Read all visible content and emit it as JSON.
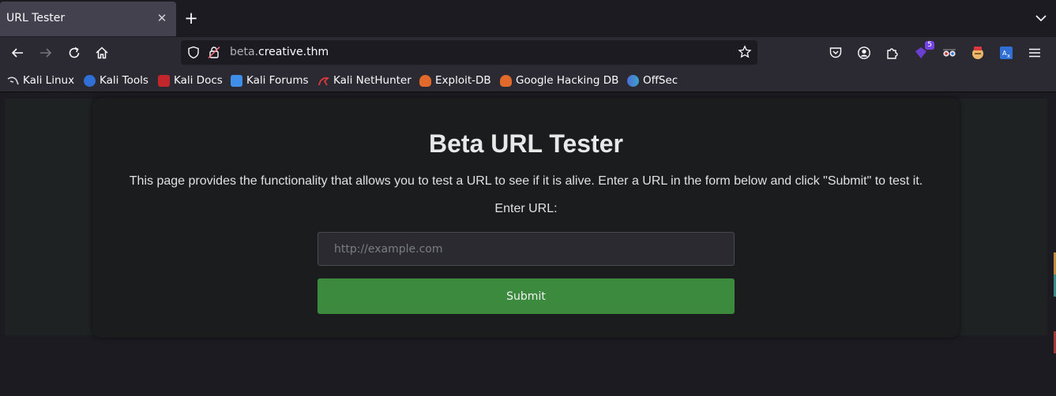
{
  "browser": {
    "tab": {
      "title": "URL Tester",
      "close": "✕"
    },
    "new_tab": "+",
    "url": {
      "subdomain": "beta.",
      "host": "creative.thm"
    },
    "extension_badge": "5"
  },
  "bookmarks": [
    {
      "label": "Kali Linux",
      "icon": "kali-dragon-icon",
      "color": "#1b1b1b"
    },
    {
      "label": "Kali Tools",
      "icon": "kali-tools-icon",
      "color": "#2f6fd6"
    },
    {
      "label": "Kali Docs",
      "icon": "kali-docs-icon",
      "color": "#c0262b"
    },
    {
      "label": "Kali Forums",
      "icon": "kali-forums-icon",
      "color": "#3f8fe8"
    },
    {
      "label": "Kali NetHunter",
      "icon": "kali-nethunter-icon",
      "color": "#d8383c"
    },
    {
      "label": "Exploit-DB",
      "icon": "exploit-db-icon",
      "color": "#e0692b"
    },
    {
      "label": "Google Hacking DB",
      "icon": "ghdb-icon",
      "color": "#e0692b"
    },
    {
      "label": "OffSec",
      "icon": "offsec-icon",
      "color": "#4a6fd8"
    }
  ],
  "page": {
    "title": "Beta URL Tester",
    "description": "This page provides the functionality that allows you to test a URL to see if it is alive. Enter a URL in the form below and click \"Submit\" to test it.",
    "input_label": "Enter URL:",
    "input_placeholder": "http://example.com",
    "input_value": "",
    "submit_label": "Submit"
  },
  "colors": {
    "submit_bg": "#3b8a3e",
    "card_bg": "#1b1c1e",
    "toolbar_bg": "#2b2a33"
  }
}
